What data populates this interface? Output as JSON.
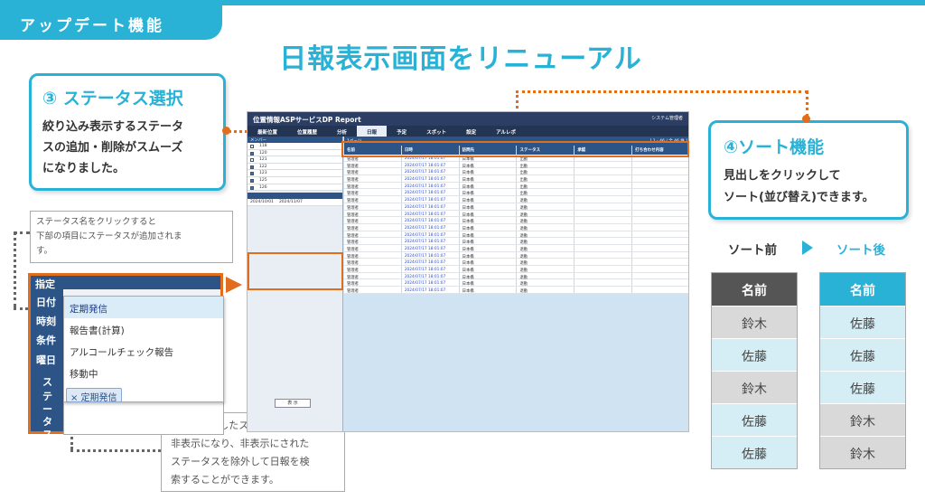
{
  "badge": "アップデート機能",
  "headline": "日報表示画面をリニューアル",
  "callout_status": {
    "title": "③ ステータス選択",
    "lines": [
      "絞り込み表示するステータ",
      "スの追加・削除がスムーズ",
      "になりました。"
    ]
  },
  "callout_sort": {
    "title": "④ソート機能",
    "lines": [
      "見出しをクリックして",
      "ソート(並び替え)できます。"
    ]
  },
  "note_add": [
    "ステータス名をクリックすると",
    "下部の項目にステータスが追加されま",
    "す。"
  ],
  "note_remove": [
    "「×」を押したステータスは",
    "非表示になり、非表示にされた",
    "ステータスを除外して日報を検",
    "索することができます。"
  ],
  "app": {
    "title": "位置情報ASPサービスDP Report",
    "user": "システム管理者",
    "nav": [
      "最新位置",
      "位置履歴",
      "分析",
      "日報",
      "予定",
      "スポット",
      "設定",
      "アルレポ"
    ],
    "active_nav": "日報",
    "side_header": "メンバー",
    "side_rows": [
      {
        "checked": false,
        "id": "118"
      },
      {
        "checked": true,
        "id": "120"
      },
      {
        "checked": false,
        "id": "121"
      },
      {
        "checked": true,
        "id": "122"
      },
      {
        "checked": true,
        "id": "123"
      },
      {
        "checked": true,
        "id": "125"
      },
      {
        "checked": true,
        "id": "126"
      }
    ],
    "range_from": "2024/10/01",
    "range_to": "2024/11/07",
    "page_info": "[ 1 - 46 / 全 46 件 ]",
    "page_label": "1ページ",
    "columns": [
      "名前",
      "日時",
      "訪問先",
      "ステータス",
      "承認",
      "打ち合わせ内容"
    ],
    "rows": [
      [
        "管理者",
        "2024/07/17 18:01:07",
        "日本橋",
        "出勤"
      ],
      [
        "管理者",
        "2024/07/17 18:01:07",
        "日本橋",
        "出勤"
      ],
      [
        "管理者",
        "2024/07/17 18:01:07",
        "日本橋",
        "出勤"
      ],
      [
        "管理者",
        "2024/07/17 18:01:07",
        "日本橋",
        "出勤"
      ],
      [
        "管理者",
        "2024/07/17 18:01:07",
        "日本橋",
        "出勤"
      ],
      [
        "管理者",
        "2024/07/17 18:01:07",
        "日本橋",
        "出勤"
      ],
      [
        "管理者",
        "2024/07/17 18:01:07",
        "日本橋",
        "退勤"
      ],
      [
        "管理者",
        "2024/07/17 18:01:07",
        "日本橋",
        "退勤"
      ],
      [
        "管理者",
        "2024/07/17 18:01:07",
        "日本橋",
        "退勤"
      ],
      [
        "管理者",
        "2024/07/17 18:01:07",
        "日本橋",
        "退勤"
      ],
      [
        "管理者",
        "2024/07/17 18:01:07",
        "日本橋",
        "退勤"
      ],
      [
        "管理者",
        "2024/07/17 18:01:07",
        "日本橋",
        "退勤"
      ],
      [
        "管理者",
        "2024/07/17 18:01:07",
        "日本橋",
        "退勤"
      ],
      [
        "管理者",
        "2024/07/17 18:01:07",
        "日本橋",
        "退勤"
      ],
      [
        "管理者",
        "2024/07/17 18:01:07",
        "日本橋",
        "退勤"
      ],
      [
        "管理者",
        "2024/07/17 18:01:07",
        "日本橋",
        "退勤"
      ],
      [
        "管理者",
        "2024/07/17 18:01:07",
        "日本橋",
        "退勤"
      ],
      [
        "管理者",
        "2024/07/17 18:01:07",
        "日本橋",
        "退勤"
      ],
      [
        "管理者",
        "2024/07/17 18:01:07",
        "日本橋",
        "退勤"
      ],
      [
        "管理者",
        "2024/07/17 18:01:07",
        "日本橋",
        "退勤"
      ]
    ],
    "search_button": "表 示"
  },
  "zoom": {
    "header": "指定",
    "labels": [
      "日付",
      "時刻",
      "条件",
      "曜日",
      "ス",
      "テ",
      "ー",
      "タ",
      "ス"
    ],
    "options": [
      "定期発信",
      "報告書(計算)",
      "アルコールチェック報告",
      "移動中"
    ],
    "selected_option": "定期発信",
    "chip": "× 定期発信"
  },
  "sort": {
    "before_label": "ソート前",
    "after_label": "ソート後",
    "header": "名前",
    "before": [
      "鈴木",
      "佐藤",
      "鈴木",
      "佐藤",
      "佐藤"
    ],
    "after": [
      "佐藤",
      "佐藤",
      "佐藤",
      "鈴木",
      "鈴木"
    ],
    "colors": {
      "dark": "#555555",
      "accent": "#2ab2d6",
      "grey_cell": "#d9d9d9",
      "blue_cell": "#d5eef6"
    }
  }
}
